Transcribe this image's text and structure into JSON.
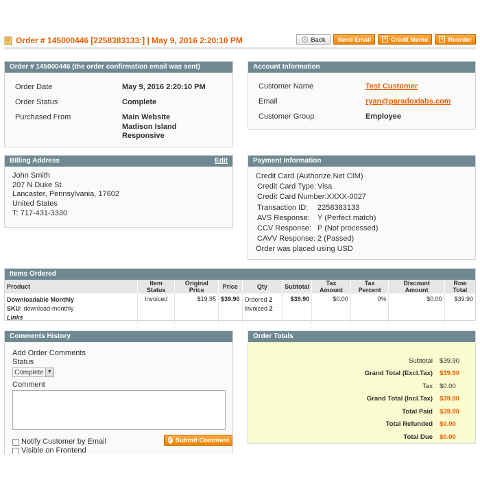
{
  "header": {
    "title": "Order # 145000446 [2258383133:] | May 9, 2016 2:20:10 PM",
    "buttons": {
      "back": "Back",
      "send_email": "Send Email",
      "credit_memo": "Credit Memo",
      "reorder": "Reorder"
    }
  },
  "order_box": {
    "title": "Order # 145000446 (the order confirmation email was sent)",
    "rows": [
      {
        "label": "Order Date",
        "value": "May 9, 2016 2:20:10 PM"
      },
      {
        "label": "Order Status",
        "value": "Complete"
      },
      {
        "label": "Purchased From",
        "value": [
          "Main Website",
          "Madison Island",
          "Responsive"
        ]
      }
    ]
  },
  "account_box": {
    "title": "Account Information",
    "rows": [
      {
        "label": "Customer Name",
        "value": "Test Customer"
      },
      {
        "label": "Email",
        "value": "ryan@paradoxlabs.com"
      },
      {
        "label": "Customer Group",
        "value": "Employee"
      }
    ]
  },
  "billing_box": {
    "title": "Billing Address",
    "edit": "Edit",
    "lines": [
      "John Smith",
      "207 N Duke St.",
      "Lancaster, Pennsylvania, 17602",
      "United States",
      "T: 717-431-3330"
    ]
  },
  "payment_box": {
    "title": "Payment Information",
    "method": "Credit Card (Authorize.Net CIM)",
    "rows": [
      {
        "label": "Credit Card Type:",
        "value": "Visa"
      },
      {
        "label": "Credit Card Number:",
        "value": "XXXX-0027"
      },
      {
        "label": "Transaction ID:",
        "value": "2258383133"
      },
      {
        "label": "AVS Response:",
        "value": "Y (Perfect match)"
      },
      {
        "label": "CCV Response:",
        "value": "P (Not processed)"
      },
      {
        "label": "CAVV Response:",
        "value": "2 (Passed)"
      }
    ],
    "currency_note": "Order was placed using USD"
  },
  "items": {
    "title": "Items Ordered",
    "columns": [
      "Product",
      "Item Status",
      "Original Price",
      "Price",
      "Qty",
      "Subtotal",
      "Tax Amount",
      "Tax Percent",
      "Discount Amount",
      "Row Total"
    ],
    "row": {
      "product": "Downloadable Monthly",
      "sku_label": "SKU:",
      "sku": "download-monthly",
      "links": "Links",
      "status": "Invoiced",
      "original_price": "$19.95",
      "price": "$39.90",
      "qty_ordered_label": "Ordered",
      "qty_ordered": "2",
      "qty_invoiced_label": "Invoiced",
      "qty_invoiced": "2",
      "subtotal": "$39.90",
      "tax_amount": "$0.00",
      "tax_percent": "0%",
      "discount": "$0.00",
      "row_total": "$39.90"
    }
  },
  "comments": {
    "title": "Comments History",
    "add_label": "Add Order Comments",
    "status_label": "Status",
    "status_value": "Complete",
    "comment_label": "Comment",
    "comment_value": "",
    "notify_label": "Notify Customer by Email",
    "visible_label": "Visible on Frontend",
    "submit": "Submit Comment"
  },
  "totals": {
    "title": "Order Totals",
    "rows": [
      {
        "label": "Subtotal",
        "value": "$39.90",
        "bold": false,
        "orange": false
      },
      {
        "label": "Grand Total (Excl.Tax)",
        "value": "$39.90",
        "bold": true,
        "orange": true
      },
      {
        "label": "Tax",
        "value": "$0.00",
        "bold": false,
        "orange": false
      },
      {
        "label": "Grand Total (Incl.Tax)",
        "value": "$39.90",
        "bold": true,
        "orange": true
      },
      {
        "label": "Total Paid",
        "value": "$39.90",
        "bold": true,
        "orange": true
      },
      {
        "label": "Total Refunded",
        "value": "$0.00",
        "bold": true,
        "orange": true
      },
      {
        "label": "Total Due",
        "value": "$0.00",
        "bold": true,
        "orange": true
      }
    ]
  },
  "colors": {
    "accent": "#eb5e00",
    "box_header": "#6f8992",
    "totals_bg": "#fbfbd0"
  }
}
